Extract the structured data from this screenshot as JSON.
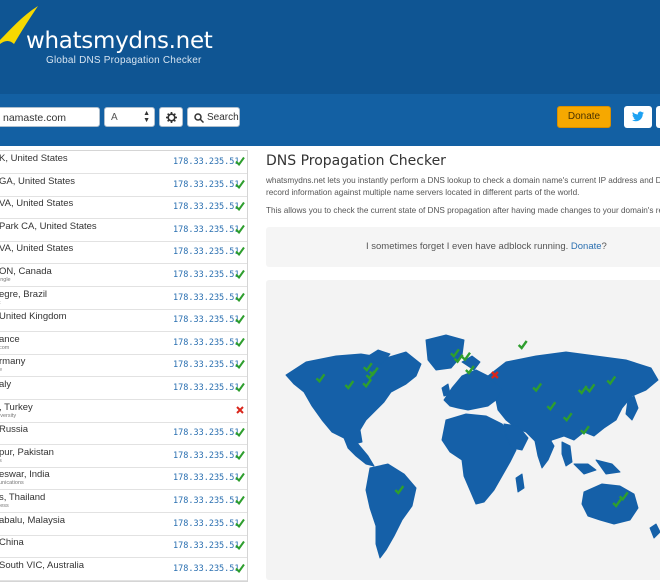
{
  "header": {
    "logo_title": "whatsmydns.net",
    "logo_subtitle": "Global DNS Propagation Checker",
    "logo_icon": "swoosh-logo"
  },
  "search": {
    "domain_value": "namaste.com",
    "record_type": "A",
    "settings_icon": "gear-icon",
    "search_label": "Search",
    "search_icon": "search-icon"
  },
  "actions": {
    "donate_label": "Donate",
    "twitter_icon": "twitter-icon"
  },
  "colors": {
    "header_bg": "#0f5593",
    "toolbar_bg": "#1360a3",
    "donate": "#f6a800",
    "ok": "#2e9e2e",
    "fail": "#d9261c",
    "map_land": "#1560a8"
  },
  "results": [
    {
      "location": "K, United States",
      "provider": "",
      "ip": "178.33.235.51",
      "status": "ok"
    },
    {
      "location": "GA, United States",
      "provider": "",
      "ip": "178.33.235.51",
      "status": "ok"
    },
    {
      "location": "VA, United States",
      "provider": "",
      "ip": "178.33.235.51",
      "status": "ok"
    },
    {
      "location": "Park CA, United States",
      "provider": "",
      "ip": "178.33.235.51",
      "status": "ok"
    },
    {
      "location": "VA, United States",
      "provider": "",
      "ip": "178.33.235.51",
      "status": "ok"
    },
    {
      "location": "ON, Canada",
      "provider": "ingle",
      "ip": "178.33.235.51",
      "status": "ok"
    },
    {
      "location": "egre, Brazil",
      "provider": "t",
      "ip": "178.33.235.51",
      "status": "ok"
    },
    {
      "location": "United Kingdom",
      "provider": "",
      "ip": "178.33.235.51",
      "status": "ok"
    },
    {
      "location": "ance",
      "provider": "com",
      "ip": "178.33.235.51",
      "status": "ok"
    },
    {
      "location": "rmany",
      "provider": "e",
      "ip": "178.33.235.51",
      "status": "ok"
    },
    {
      "location": "aly",
      "provider": "",
      "ip": "178.33.235.51",
      "status": "ok"
    },
    {
      "location": ", Turkey",
      "provider": "iversity",
      "ip": "",
      "status": "fail"
    },
    {
      "location": "Russia",
      "provider": "",
      "ip": "178.33.235.51",
      "status": "ok"
    },
    {
      "location": "pur, Pakistan",
      "provider": "s",
      "ip": "178.33.235.51",
      "status": "ok"
    },
    {
      "location": "eswar, India",
      "provider": "unications",
      "ip": "178.33.235.51",
      "status": "ok"
    },
    {
      "location": "s, Thailand",
      "provider": "less",
      "ip": "178.33.235.51",
      "status": "ok"
    },
    {
      "location": "abalu, Malaysia",
      "provider": "",
      "ip": "178.33.235.51",
      "status": "ok"
    },
    {
      "location": "China",
      "provider": "",
      "ip": "178.33.235.51",
      "status": "ok"
    },
    {
      "location": "South VIC, Australia",
      "provider": "",
      "ip": "178.33.235.51",
      "status": "ok"
    }
  ],
  "content": {
    "title": "DNS Propagation Checker",
    "desc_line1": "whatsmydns.net lets you instantly perform a DNS lookup to check a domain name's current IP address and D",
    "desc_line2": "record information against multiple name servers located in different parts of the world.",
    "desc_line3": "This allows you to check the current state of DNS propagation after having made changes to your domain's re",
    "adblock_text": "I sometimes forget I even have adblock running.",
    "adblock_link": "Donate",
    "adblock_end": "?"
  },
  "map_markers": [
    {
      "name": "map-marker-us-west",
      "lon": -122,
      "lat": 37,
      "status": "ok"
    },
    {
      "name": "map-marker-us-central",
      "lon": -96,
      "lat": 33,
      "status": "ok"
    },
    {
      "name": "map-marker-us-east-1",
      "lon": -80,
      "lat": 34,
      "status": "ok"
    },
    {
      "name": "map-marker-us-east-2",
      "lon": -77,
      "lat": 38.9,
      "status": "ok"
    },
    {
      "name": "map-marker-us-east-3",
      "lon": -74,
      "lat": 41,
      "status": "ok"
    },
    {
      "name": "map-marker-canada",
      "lon": -79.4,
      "lat": 43.7,
      "status": "ok"
    },
    {
      "name": "map-marker-brazil",
      "lon": -51,
      "lat": -30,
      "status": "ok"
    },
    {
      "name": "map-marker-uk",
      "lon": -1,
      "lat": 52,
      "status": "ok"
    },
    {
      "name": "map-marker-france",
      "lon": 2.3,
      "lat": 48.8,
      "status": "ok"
    },
    {
      "name": "map-marker-germany",
      "lon": 9,
      "lat": 50,
      "status": "ok"
    },
    {
      "name": "map-marker-italy",
      "lon": 12.5,
      "lat": 42,
      "status": "ok"
    },
    {
      "name": "map-marker-turkey",
      "lon": 35,
      "lat": 39,
      "status": "fail"
    },
    {
      "name": "map-marker-russia",
      "lon": 60,
      "lat": 57,
      "status": "ok"
    },
    {
      "name": "map-marker-pakistan",
      "lon": 73,
      "lat": 31.5,
      "status": "ok"
    },
    {
      "name": "map-marker-india",
      "lon": 85.8,
      "lat": 20.3,
      "status": "ok"
    },
    {
      "name": "map-marker-thailand",
      "lon": 100.5,
      "lat": 13.7,
      "status": "ok"
    },
    {
      "name": "map-marker-malaysia",
      "lon": 116,
      "lat": 5.9,
      "status": "ok"
    },
    {
      "name": "map-marker-china",
      "lon": 114,
      "lat": 30,
      "status": "ok"
    },
    {
      "name": "map-marker-china-2",
      "lon": 121,
      "lat": 31,
      "status": "ok"
    },
    {
      "name": "map-marker-japan",
      "lon": 139.7,
      "lat": 35.7,
      "status": "ok"
    },
    {
      "name": "map-marker-australia",
      "lon": 145,
      "lat": -37.8,
      "status": "ok"
    },
    {
      "name": "map-marker-australia-2",
      "lon": 151,
      "lat": -33.8,
      "status": "ok"
    }
  ]
}
